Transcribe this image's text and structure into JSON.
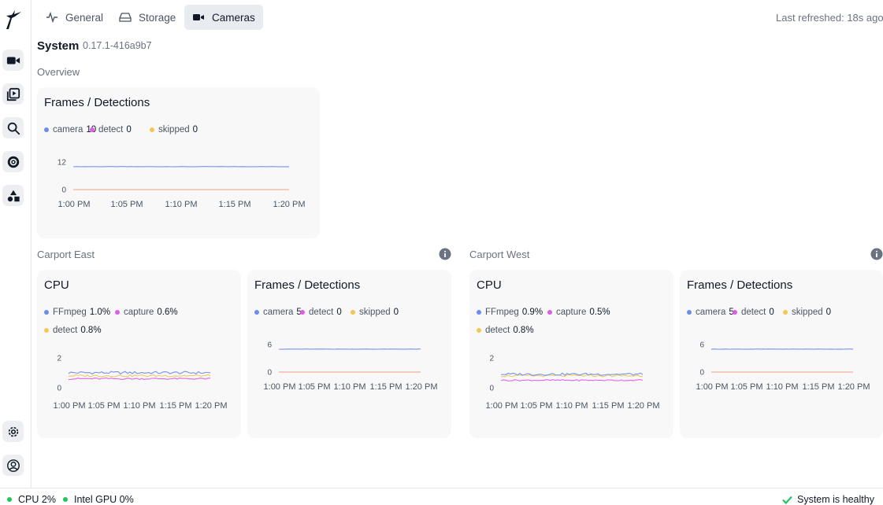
{
  "tabs": [
    {
      "label": "General",
      "icon": "activity-icon",
      "active": false
    },
    {
      "label": "Storage",
      "icon": "hard-drive-icon",
      "active": false
    },
    {
      "label": "Cameras",
      "icon": "video-icon",
      "active": true
    }
  ],
  "last_refreshed": "Last refreshed: 18s ago",
  "system": {
    "title": "System",
    "version": "0.17.1-416a9b7"
  },
  "sidebar": {
    "items": [
      "video-icon",
      "play-library-icon",
      "search-icon",
      "explore-icon",
      "objects-icon"
    ],
    "bottom": [
      "settings-icon",
      "account-icon"
    ]
  },
  "overview": {
    "label": "Overview",
    "card": {
      "title": "Frames / Detections",
      "legend": [
        {
          "name": "camera",
          "value": "10",
          "color": "#6b8cf0"
        },
        {
          "name": "detect",
          "value": "0",
          "color": "#e05de8"
        },
        {
          "name": "skipped",
          "value": "0",
          "color": "#f4c653"
        }
      ],
      "yticks": [
        "12",
        "0"
      ],
      "xticks": [
        "1:00 PM",
        "1:05 PM",
        "1:10 PM",
        "1:15 PM",
        "1:20 PM"
      ]
    }
  },
  "cameras": [
    {
      "name": "Carport East",
      "cpu": {
        "title": "CPU",
        "legend": [
          {
            "name": "FFmpeg",
            "value": "1.0%",
            "color": "#6b8cf0"
          },
          {
            "name": "capture",
            "value": "0.6%",
            "color": "#e05de8"
          },
          {
            "name": "detect",
            "value": "0.8%",
            "color": "#f4c653"
          }
        ],
        "yticks": [
          "2",
          "0"
        ],
        "xticks": [
          "1:00 PM",
          "1:05 PM",
          "1:10 PM",
          "1:15 PM",
          "1:20 PM"
        ]
      },
      "frames": {
        "title": "Frames / Detections",
        "legend": [
          {
            "name": "camera",
            "value": "5",
            "color": "#6b8cf0"
          },
          {
            "name": "detect",
            "value": "0",
            "color": "#e05de8"
          },
          {
            "name": "skipped",
            "value": "0",
            "color": "#f4c653"
          }
        ],
        "yticks": [
          "6",
          "0"
        ],
        "xticks": [
          "1:00 PM",
          "1:05 PM",
          "1:10 PM",
          "1:15 PM",
          "1:20 PM"
        ]
      }
    },
    {
      "name": "Carport West",
      "cpu": {
        "title": "CPU",
        "legend": [
          {
            "name": "FFmpeg",
            "value": "0.9%",
            "color": "#6b8cf0"
          },
          {
            "name": "capture",
            "value": "0.5%",
            "color": "#e05de8"
          },
          {
            "name": "detect",
            "value": "0.8%",
            "color": "#f4c653"
          }
        ],
        "yticks": [
          "2",
          "0"
        ],
        "xticks": [
          "1:00 PM",
          "1:05 PM",
          "1:10 PM",
          "1:15 PM",
          "1:20 PM"
        ]
      },
      "frames": {
        "title": "Frames / Detections",
        "legend": [
          {
            "name": "camera",
            "value": "5",
            "color": "#6b8cf0"
          },
          {
            "name": "detect",
            "value": "0",
            "color": "#e05de8"
          },
          {
            "name": "skipped",
            "value": "0",
            "color": "#f4c653"
          }
        ],
        "yticks": [
          "6",
          "0"
        ],
        "xticks": [
          "1:00 PM",
          "1:05 PM",
          "1:10 PM",
          "1:15 PM",
          "1:20 PM"
        ]
      }
    }
  ],
  "footer": {
    "cpu": "CPU 2%",
    "gpu": "Intel GPU 0%",
    "health": "System is healthy"
  },
  "colors": {
    "healthy": "#22c55e",
    "zero_line": "#f0a08a"
  },
  "chart_data": [
    {
      "type": "line",
      "title": "Frames / Detections",
      "x": [
        "1:00 PM",
        "1:05 PM",
        "1:10 PM",
        "1:15 PM",
        "1:20 PM"
      ],
      "ylim": [
        0,
        12
      ],
      "series": [
        {
          "name": "camera",
          "values": [
            10,
            10,
            10,
            10,
            10
          ]
        },
        {
          "name": "detect",
          "values": [
            0,
            0,
            0,
            0,
            0
          ]
        },
        {
          "name": "skipped",
          "values": [
            0,
            0,
            0,
            0,
            0
          ]
        }
      ]
    },
    {
      "type": "line",
      "title": "CPU",
      "x": [
        "1:00 PM",
        "1:05 PM",
        "1:10 PM",
        "1:15 PM",
        "1:20 PM"
      ],
      "ylim": [
        0,
        2
      ],
      "series": [
        {
          "name": "FFmpeg",
          "values": [
            1.0,
            1.0,
            1.0,
            1.0,
            1.0
          ]
        },
        {
          "name": "capture",
          "values": [
            0.6,
            0.6,
            0.6,
            0.6,
            0.6
          ]
        },
        {
          "name": "detect",
          "values": [
            0.8,
            0.8,
            0.8,
            0.8,
            0.8
          ]
        }
      ]
    },
    {
      "type": "line",
      "title": "Frames / Detections",
      "x": [
        "1:00 PM",
        "1:05 PM",
        "1:10 PM",
        "1:15 PM",
        "1:20 PM"
      ],
      "ylim": [
        0,
        6
      ],
      "series": [
        {
          "name": "camera",
          "values": [
            5,
            5,
            5,
            5,
            5
          ]
        },
        {
          "name": "detect",
          "values": [
            0,
            0,
            0,
            0,
            0
          ]
        },
        {
          "name": "skipped",
          "values": [
            0,
            0,
            0,
            0,
            0
          ]
        }
      ]
    },
    {
      "type": "line",
      "title": "CPU",
      "x": [
        "1:00 PM",
        "1:05 PM",
        "1:10 PM",
        "1:15 PM",
        "1:20 PM"
      ],
      "ylim": [
        0,
        2
      ],
      "series": [
        {
          "name": "FFmpeg",
          "values": [
            0.9,
            0.9,
            0.9,
            0.9,
            0.9
          ]
        },
        {
          "name": "capture",
          "values": [
            0.5,
            0.5,
            0.5,
            0.5,
            0.5
          ]
        },
        {
          "name": "detect",
          "values": [
            0.8,
            0.8,
            0.8,
            0.8,
            0.8
          ]
        }
      ]
    },
    {
      "type": "line",
      "title": "Frames / Detections",
      "x": [
        "1:00 PM",
        "1:05 PM",
        "1:10 PM",
        "1:15 PM",
        "1:20 PM"
      ],
      "ylim": [
        0,
        6
      ],
      "series": [
        {
          "name": "camera",
          "values": [
            5,
            5,
            5,
            5,
            5
          ]
        },
        {
          "name": "detect",
          "values": [
            0,
            0,
            0,
            0,
            0
          ]
        },
        {
          "name": "skipped",
          "values": [
            0,
            0,
            0,
            0,
            0
          ]
        }
      ]
    }
  ]
}
